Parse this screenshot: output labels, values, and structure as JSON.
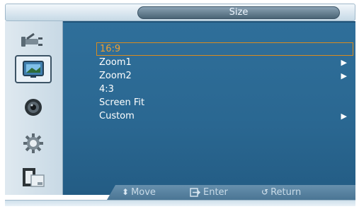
{
  "title": "Size",
  "sidebar": {
    "items": [
      {
        "icon": "input-plug-icon"
      },
      {
        "icon": "picture-icon",
        "selected": true
      },
      {
        "icon": "sound-speaker-icon"
      },
      {
        "icon": "setup-gear-icon"
      },
      {
        "icon": "multi-control-icon"
      }
    ]
  },
  "menu": {
    "items": [
      {
        "label": "16:9",
        "selected": true,
        "has_submenu": false
      },
      {
        "label": "Zoom1",
        "has_submenu": true
      },
      {
        "label": "Zoom2",
        "has_submenu": true
      },
      {
        "label": "4:3",
        "has_submenu": false
      },
      {
        "label": "Screen Fit",
        "has_submenu": false
      },
      {
        "label": "Custom",
        "has_submenu": true
      }
    ],
    "arrow": "▶"
  },
  "guide": {
    "move": "Move",
    "enter": "Enter",
    "return": "Return",
    "move_icon": "⬍",
    "return_icon": "↺"
  },
  "colors": {
    "panel": "#2a6791",
    "selected_text": "#f0a030",
    "text": "#ffffff"
  }
}
